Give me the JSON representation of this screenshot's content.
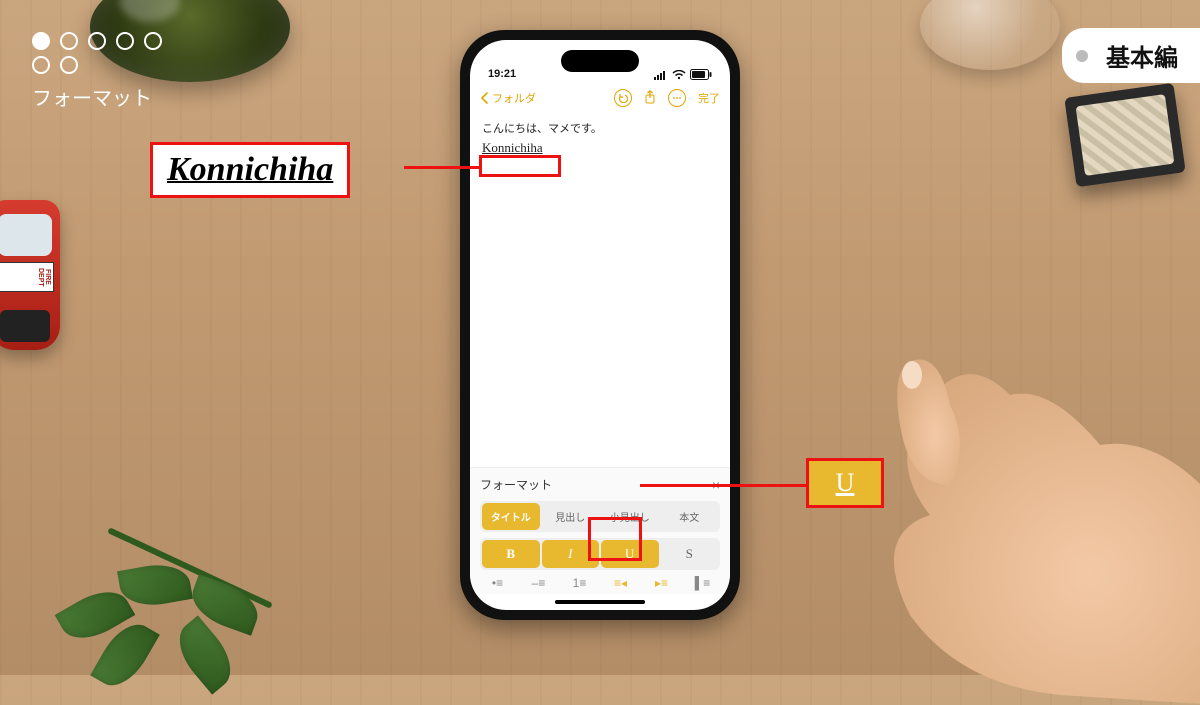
{
  "progress": {
    "label": "フォーマット",
    "index": 1,
    "total": 7
  },
  "chapter": {
    "label": "基本編"
  },
  "phone": {
    "status": {
      "time": "19:21",
      "signal": "••••",
      "wifi": "wifi",
      "battery": "80"
    },
    "nav": {
      "back": "フォルダ",
      "done": "完了"
    },
    "note": {
      "line1": "こんにちは、マメです。",
      "word": "Konnichiha"
    },
    "format": {
      "title": "フォーマット",
      "styles": {
        "title": "タイトル",
        "heading": "見出し",
        "subheading": "小見出し",
        "body": "本文"
      },
      "biu": {
        "b": "B",
        "i": "I",
        "u": "U",
        "s": "S"
      }
    }
  },
  "callouts": {
    "word_big": "Konnichiha",
    "u_label": "U"
  },
  "toycar": {
    "label": "FIRE DEPT"
  }
}
